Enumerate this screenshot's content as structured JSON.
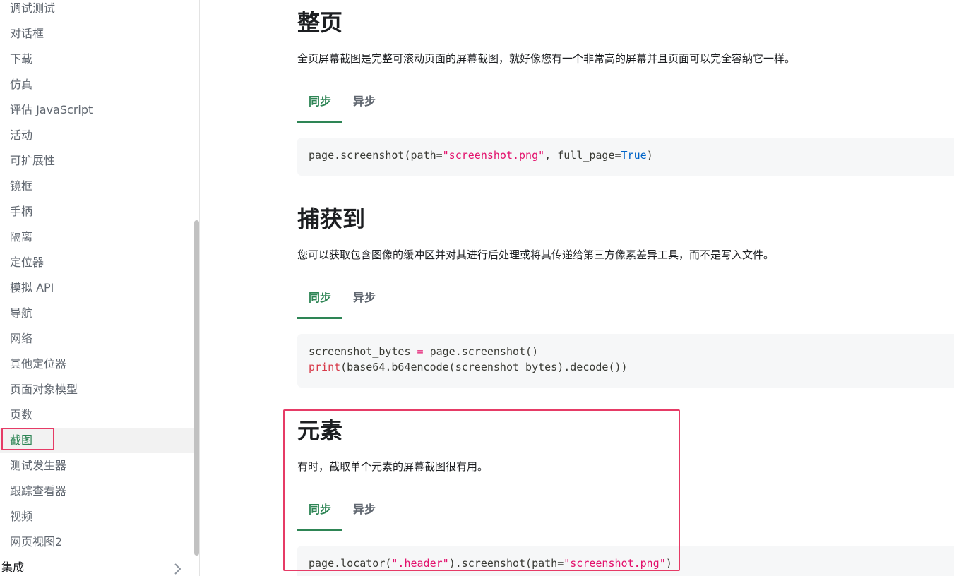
{
  "sidebar": {
    "items": [
      {
        "label": "调试测试"
      },
      {
        "label": "对话框"
      },
      {
        "label": "下载"
      },
      {
        "label": "仿真"
      },
      {
        "label": "评估 JavaScript"
      },
      {
        "label": "活动"
      },
      {
        "label": "可扩展性"
      },
      {
        "label": "镜框"
      },
      {
        "label": "手柄"
      },
      {
        "label": "隔离"
      },
      {
        "label": "定位器"
      },
      {
        "label": "模拟 API"
      },
      {
        "label": "导航"
      },
      {
        "label": "网络"
      },
      {
        "label": "其他定位器"
      },
      {
        "label": "页面对象模型"
      },
      {
        "label": "页数"
      },
      {
        "label": "截图",
        "active": true
      },
      {
        "label": "测试发生器"
      },
      {
        "label": "跟踪查看器"
      },
      {
        "label": "视频"
      },
      {
        "label": "网页视图2"
      }
    ],
    "category": {
      "label": "集成",
      "icon": "chevron-right-icon"
    }
  },
  "sections": [
    {
      "title": "整页",
      "description": "全页屏幕截图是完整可滚动页面的屏幕截图，就好像您有一个非常高的屏幕并且页面可以完全容纳它一样。",
      "tabs": [
        "同步",
        "异步"
      ],
      "code": "page.screenshot(path=\"screenshot.png\", full_page=True)"
    },
    {
      "title": "捕获到",
      "description": "您可以获取包含图像的缓冲区并对其进行后处理或将其传递给第三方像素差异工具，而不是写入文件。",
      "tabs": [
        "同步",
        "异步"
      ],
      "code": "screenshot_bytes = page.screenshot()\nprint(base64.b64encode(screenshot_bytes).decode())"
    },
    {
      "title": "元素",
      "description": "有时，截取单个元素的屏幕截图很有用。",
      "tabs": [
        "同步",
        "异步"
      ],
      "code": "page.locator(\".header\").screenshot(path=\"screenshot.png\")"
    }
  ],
  "colors": {
    "accent": "#2e8555",
    "highlight": "#e63b66"
  }
}
